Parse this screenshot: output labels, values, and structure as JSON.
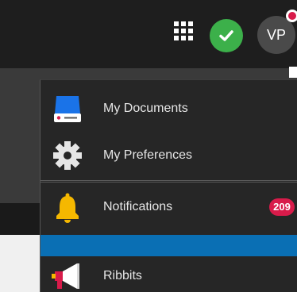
{
  "header": {
    "apps_icon": "grid-icon",
    "status_icon": "check-circle-icon",
    "avatar_initials": "VP",
    "colors": {
      "bar": "#1e1e1e",
      "status": "#3cb04a",
      "notification_dot": "#d81b4a"
    }
  },
  "menu": {
    "items": [
      {
        "label": "My Documents",
        "icon": "drive-icon"
      },
      {
        "label": "My Preferences",
        "icon": "gear-icon"
      },
      {
        "label": "Notifications",
        "icon": "bell-icon",
        "badge": "209"
      },
      {
        "label": "Ribbits",
        "icon": "megaphone-icon"
      }
    ],
    "colors": {
      "background": "#262626",
      "highlight": "#0a6fb4",
      "badge": "#d81b4a",
      "bell": "#f5b800"
    }
  }
}
